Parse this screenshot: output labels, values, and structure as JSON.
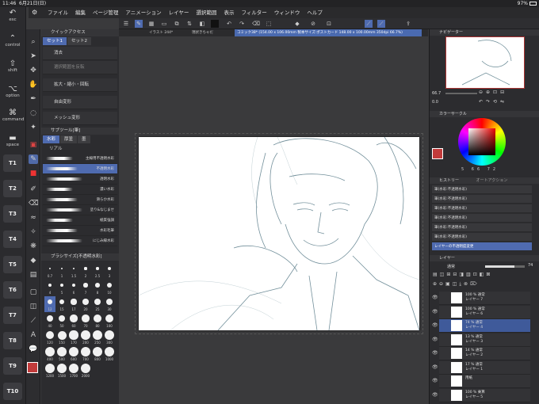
{
  "status": {
    "time": "11:46",
    "date": "6月21日(日)",
    "battery": "97%"
  },
  "menu": [
    "ファイル",
    "編集",
    "ページ管理",
    "アニメーション",
    "レイヤー",
    "選択範囲",
    "表示",
    "フィルター",
    "ウィンドウ",
    "ヘルプ"
  ],
  "left_shortcuts": [
    {
      "label": "esc",
      "icon": "undo-icon"
    },
    {
      "label": "control",
      "icon": "control-icon"
    },
    {
      "label": "shift",
      "icon": "shift-icon"
    },
    {
      "label": "option",
      "icon": "option-icon"
    },
    {
      "label": "command",
      "icon": "command-icon"
    },
    {
      "label": "space",
      "icon": "space-icon"
    }
  ],
  "t_keys": [
    "T1",
    "T2",
    "T3",
    "T4",
    "T5",
    "T6",
    "T7",
    "T8",
    "T9",
    "T10"
  ],
  "quick_access": {
    "title": "クイックアクセス",
    "tabs": [
      "セット1",
      "セット2"
    ],
    "items": [
      "消去",
      "選択範囲を反転",
      "拡大・縮小・回転",
      "自由変形",
      "メッシュ変形"
    ]
  },
  "subtool": {
    "title": "サブツール[筆]",
    "tabs": [
      "水彩",
      "厚塗",
      "墨"
    ],
    "group": "リアル",
    "brushes": [
      "主線用不透明水彩",
      "不透明水彩",
      "透明水彩",
      "濃い水彩",
      "滑らか水彩",
      "塗り&なじませ",
      "紙質強調",
      "水彩毛筆",
      "にじみ縁水彩"
    ],
    "selected_brush": "不透明水彩"
  },
  "brush_size": {
    "title": "ブラシサイズ[不透明水彩]",
    "sizes": [
      "0.7",
      "1",
      "1.5",
      "2",
      "2.5",
      "3",
      "4",
      "5",
      "6",
      "7",
      "8",
      "10",
      "12",
      "15",
      "17",
      "20",
      "25",
      "30",
      "40",
      "50",
      "60",
      "70",
      "80",
      "100",
      "120",
      "150",
      "170",
      "200",
      "250",
      "300",
      "400",
      "500",
      "600",
      "700",
      "800",
      "1000",
      "1200",
      "1500",
      "1700",
      "2000"
    ],
    "selected_size": "12"
  },
  "canvas_tabs": [
    "イラスト 244*",
    "現状きちゃだ",
    "コミック38* (154.00 x 106.00mm 製本サイズ:ポストカード 148.00 x 100.00mm 350dpi 66.7%)"
  ],
  "navigator": {
    "title": "ナビゲーター",
    "zoom": "66.7",
    "angle": "0.0"
  },
  "color_circle": {
    "title": "カラーサークル",
    "values": [
      "5",
      "66",
      "72"
    ],
    "main_color": "#c23b3b"
  },
  "history": {
    "title": "ヒストリー",
    "tab2": "オートアクション",
    "items": [
      "筆(水彩:不透明水彩)",
      "筆(水彩:不透明水彩)",
      "筆(水彩:不透明水彩)",
      "筆(水彩:不透明水彩)",
      "筆(水彩:不透明水彩)",
      "筆(水彩:不透明水彩)",
      "レイヤーの不透明度変更"
    ],
    "selected": 6
  },
  "layers_panel": {
    "title": "レイヤー",
    "blend": "通常",
    "opacity": "74",
    "layers": [
      {
        "line1": "100 % 通常",
        "line2": "レイヤー 7"
      },
      {
        "line1": "100 % 通常",
        "line2": "レイヤー 6"
      },
      {
        "line1": "74 % 通常",
        "line2": "レイヤー 4"
      },
      {
        "line1": "13 % 通常",
        "line2": "レイヤー 3"
      },
      {
        "line1": "14 % 通常",
        "line2": "レイヤー 2"
      },
      {
        "line1": "17 % 通常",
        "line2": "レイヤー 1"
      },
      {
        "line1": "",
        "line2": "用紙"
      },
      {
        "line1": "100 % 乗算",
        "line2": "レイヤー 5"
      }
    ],
    "selected": 2
  }
}
